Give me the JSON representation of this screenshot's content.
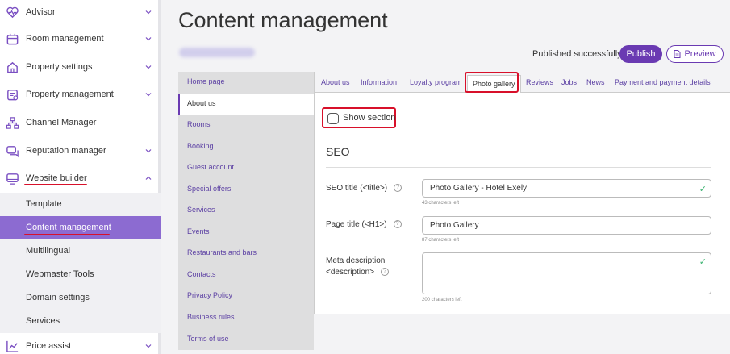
{
  "sidebar": {
    "items": [
      {
        "label": "Advisor",
        "icon": "heart-pulse-icon"
      },
      {
        "label": "Room management",
        "icon": "calendar-icon"
      },
      {
        "label": "Property settings",
        "icon": "home-icon"
      },
      {
        "label": "Property management",
        "icon": "clipboard-icon"
      },
      {
        "label": "Channel Manager",
        "icon": "sitemap-icon"
      },
      {
        "label": "Reputation manager",
        "icon": "chat-icon"
      },
      {
        "label": "Website builder",
        "icon": "monitor-icon"
      },
      {
        "label": "Price assist",
        "icon": "chart-line-icon"
      }
    ],
    "subitems": [
      {
        "label": "Template"
      },
      {
        "label": "Content management"
      },
      {
        "label": "Multilingual"
      },
      {
        "label": "Webmaster Tools"
      },
      {
        "label": "Domain settings"
      },
      {
        "label": "Services"
      }
    ]
  },
  "header": {
    "title": "Content management",
    "status": "Published successfully",
    "publish_label": "Publish",
    "preview_label": "Preview"
  },
  "pages": [
    "Home page",
    "About us",
    "Rooms",
    "Booking",
    "Guest account",
    "Special offers",
    "Services",
    "Events",
    "Restaurants and bars",
    "Contacts",
    "Privacy Policy",
    "Business rules",
    "Terms of use"
  ],
  "tabs": [
    "About us",
    "Information",
    "Loyalty program",
    "Photo gallery",
    "Reviews",
    "Jobs",
    "News",
    "Payment and payment details"
  ],
  "form": {
    "show_section_label": "Show section",
    "seo_heading": "SEO",
    "seo_title_label": "SEO title (<title>)",
    "seo_title_value": "Photo Gallery - Hotel Exely",
    "seo_title_hint": "43 characters left",
    "page_title_label": "Page title (<H1>)",
    "page_title_value": "Photo Gallery",
    "page_title_hint": "87 characters left",
    "meta_label_1": "Meta description",
    "meta_label_2": "<description>",
    "meta_hint": "200 characters left",
    "help_glyph": "?",
    "check_glyph": "✓"
  },
  "colors": {
    "accent": "#6a3ab2",
    "active_nav": "#8c6bd1",
    "highlight": "#d8102a"
  }
}
